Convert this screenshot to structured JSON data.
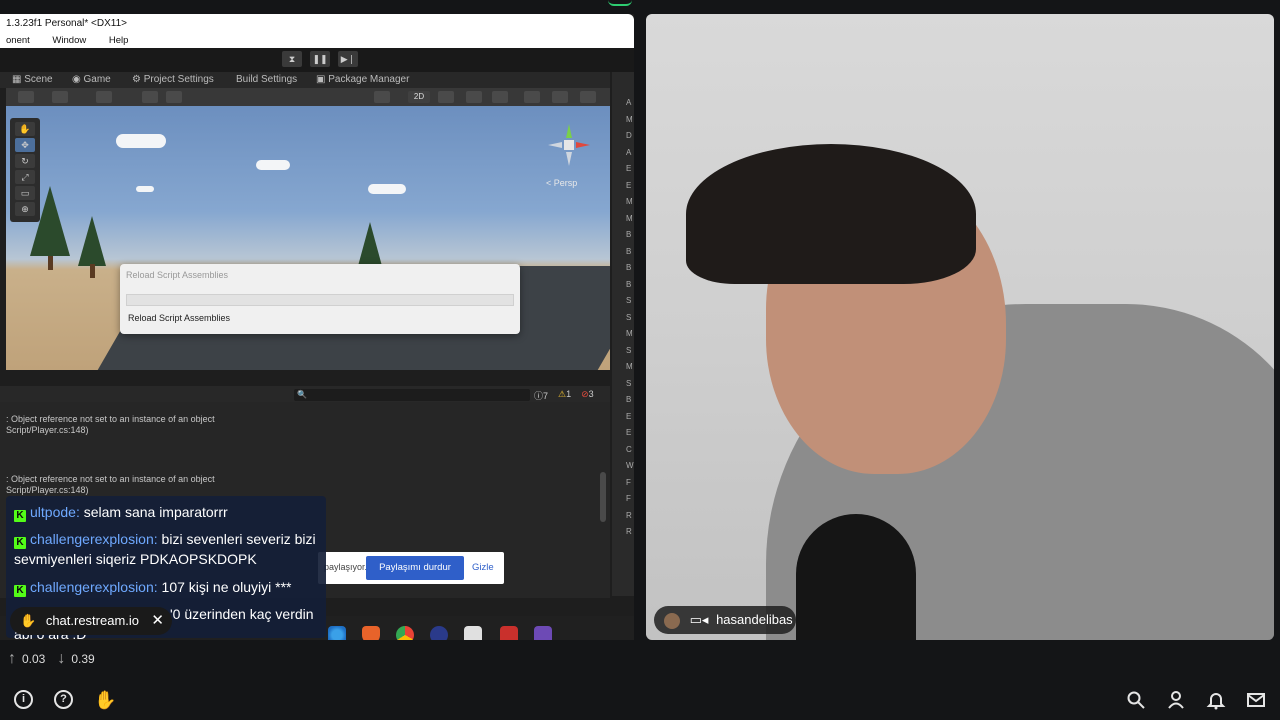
{
  "unity": {
    "title": "1.3.23f1 Personal* <DX11>",
    "menu": [
      "onent",
      "Window",
      "Help"
    ],
    "tabs": [
      "Scene",
      "Game",
      "Project Settings",
      "Build Settings",
      "Package Manager"
    ],
    "toolbar_2d": "2D",
    "persp_label": "< Persp",
    "dialog": {
      "title": "Reload Script Assemblies",
      "message": "Reload Script Assemblies"
    },
    "console": {
      "counts": {
        "info": "7",
        "warn": "1",
        "error": "3"
      },
      "lines": [
        {
          "text": ": Object reference not set to an instance of an object"
        },
        {
          "text": "Script/Player.cs:148)"
        },
        {
          "text": ": Object reference not set to an instance of an object"
        },
        {
          "text": "Script/Player.cs:148)"
        }
      ]
    },
    "right_panel_letters": [
      "A",
      "M",
      "D",
      "A",
      "E",
      "E",
      "M",
      "M",
      "B",
      "B",
      "B",
      "B",
      "S",
      "S",
      "M",
      "S",
      "M",
      "S",
      "B",
      "E",
      "E",
      "C",
      "W",
      "F",
      "F",
      "R",
      "R"
    ]
  },
  "share_banner": {
    "text": "paylaşıyor.",
    "stop": "Paylaşımı durdur",
    "hide": "Gizle"
  },
  "chat": {
    "messages": [
      {
        "user": "ultpode",
        "text": "selam sana imparatorrr"
      },
      {
        "user": "challengerexplosion",
        "text": "bizi sevenleri severiz bizi sevmiyenleri siqeriz PDKAOPSKDOPK"
      },
      {
        "user": "challengerexplosion",
        "text": "107 kişi ne oluyiyi ***"
      },
      {
        "user": "",
        "text": "'0 üzerinden kaç verdin abi o ara :D"
      }
    ],
    "restream_label": "chat.restream.io"
  },
  "webcam": {
    "name": "hasandelibas"
  },
  "stats": {
    "upload": "0.03",
    "download": "0.39"
  },
  "icons": {
    "info": "info-icon",
    "help": "help-icon",
    "logo": "hand-logo-icon",
    "search": "search-icon",
    "user": "user-icon",
    "bell": "bell-icon",
    "mail": "mail-icon"
  },
  "colors": {
    "kick_green": "#53fc18",
    "chat_user": "#6fa9ff",
    "share_button": "#2f5fc9",
    "accent_purple": "#b04fd8"
  }
}
